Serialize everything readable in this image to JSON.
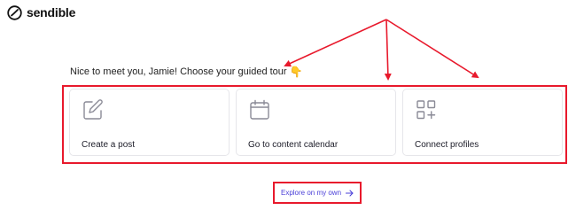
{
  "brand": {
    "name": "sendible",
    "icon": "sendible-logo-icon"
  },
  "heading": {
    "text": "Nice to meet you, Jamie! Choose your guided tour",
    "emoji": "👇"
  },
  "cards": [
    {
      "label": "Create a post",
      "icon": "edit-icon"
    },
    {
      "label": "Go to content calendar",
      "icon": "calendar-icon"
    },
    {
      "label": "Connect profiles",
      "icon": "add-grid-icon"
    }
  ],
  "explore": {
    "label": "Explore on my own",
    "icon": "arrow-right-icon",
    "color": "#4a3fd8"
  },
  "annotations": {
    "color": "#e8192c"
  }
}
